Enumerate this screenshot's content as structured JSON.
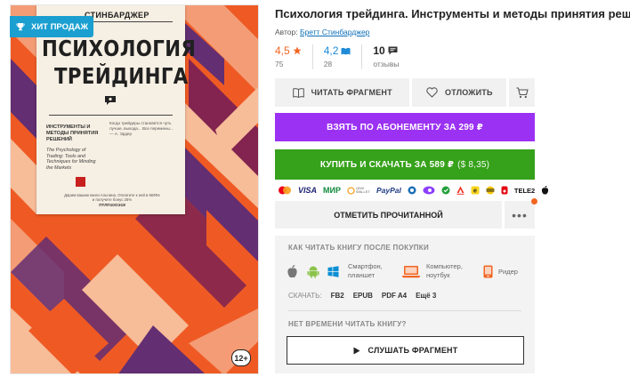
{
  "badge": {
    "label": "ХИТ ПРОДАЖ",
    "icon": "trophy-icon"
  },
  "cover": {
    "author": "СТИНБАРДЖЕР",
    "title_line1": "ПСИХОЛОГИЯ",
    "title_line2": "ТРЕЙДИНГА",
    "subtitle": "ИНСТРУМЕНТЫ И МЕТОДЫ ПРИНЯТИЯ РЕШЕНИЙ",
    "english_title": "The Psychology of Trading: Tools and Techniques for Minding the Markets",
    "blurb": "Когда трейдеры становятся чуть лучше, выхода... Все перемены... — А. Эрдер",
    "promo": "Дарим вашим книги Альпина. Оплатите к ней в МИФе и получите бонус 25%",
    "promo_code": "ПТЛП10ОЭ18",
    "age_rating": "12+",
    "colors": {
      "orange": "#ef5a24",
      "peach": "#f4a07b",
      "purple": "#5c2c77",
      "maroon": "#7d2252",
      "card": "#f6efe3"
    }
  },
  "book": {
    "title": "Психология трейдинга. Инструменты и методы принятия решений",
    "author_label": "Автор:",
    "author_name": "Бретт Стинбарджер"
  },
  "ratings": {
    "litres": {
      "value": "4,5",
      "count": "75"
    },
    "livelib": {
      "value": "4,2",
      "count": "28"
    },
    "reviews": {
      "value": "10",
      "label": "отзывы"
    }
  },
  "actions": {
    "read_fragment": "ЧИТАТЬ ФРАГМЕНТ",
    "defer": "ОТЛОЖИТЬ",
    "subscription": "ВЗЯТЬ ПО АБОНЕМЕНТУ ЗА 299 ₽",
    "buy": "КУПИТЬ И СКАЧАТЬ ЗА 589 ₽",
    "buy_usd": "($ 8,35)",
    "mark_read": "ОТМЕТИТЬ ПРОЧИТАННОЙ",
    "more": "•••"
  },
  "payments": [
    "VISA",
    "МИР",
    "QIWI WALLET",
    "PayPal",
    "TELE2"
  ],
  "how_to_read": {
    "title": "КАК ЧИТАТЬ КНИГУ ПОСЛЕ ПОКУПКИ",
    "smartphone": "Смартфон, планшет",
    "computer": "Компьютер, ноутбук",
    "reader": "Ридер",
    "download_label": "СКАЧАТЬ:",
    "formats": [
      "FB2",
      "EPUB",
      "PDF A4",
      "Ещё 3"
    ],
    "no_time": "НЕТ ВРЕМЕНИ ЧИТАТЬ КНИГУ?",
    "listen": "СЛУШАТЬ ФРАГМЕНТ"
  },
  "accent_colors": {
    "subscription": "#9b31f2",
    "buy": "#36a11a",
    "link": "#0d6fb8",
    "badge": "#1a9fd0",
    "rating_orange": "#f26522"
  }
}
